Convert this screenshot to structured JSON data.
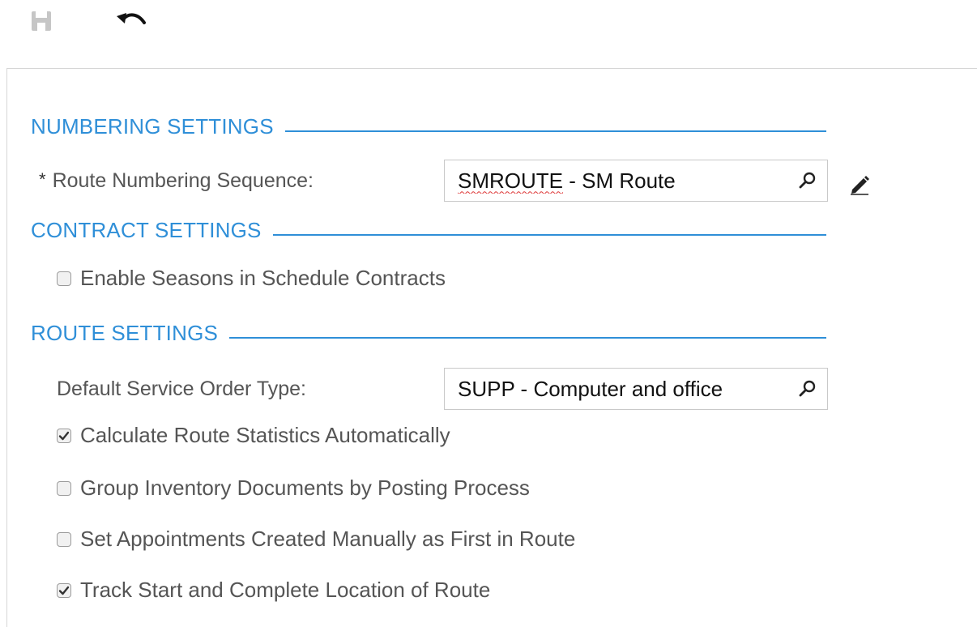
{
  "toolbar": {
    "save_icon": "floppy-disk-icon",
    "undo_icon": "undo-arrow-icon"
  },
  "sections": {
    "numbering": {
      "title": "NUMBERING SETTINGS"
    },
    "contract": {
      "title": "CONTRACT SETTINGS"
    },
    "route": {
      "title": "ROUTE SETTINGS"
    }
  },
  "fields": {
    "route_numbering": {
      "required_mark": "*",
      "label": "Route Numbering Sequence:",
      "value_code": "SMROUTE",
      "value_rest": " - SM Route"
    },
    "default_order_type": {
      "label": "Default Service Order Type:",
      "value": "SUPP - Computer and office"
    }
  },
  "checkboxes": {
    "enable_seasons": {
      "label": "Enable Seasons in Schedule Contracts",
      "checked": false
    },
    "calc_stats": {
      "label": "Calculate Route Statistics Automatically",
      "checked": true
    },
    "group_inventory": {
      "label": "Group Inventory Documents by Posting Process",
      "checked": false
    },
    "appointments_first": {
      "label": "Set Appointments Created Manually as First in Route",
      "checked": false
    },
    "track_location": {
      "label": "Track Start and Complete Location of Route",
      "checked": true
    }
  },
  "colors": {
    "section_accent": "#2f8fd8",
    "text": "#555555"
  }
}
